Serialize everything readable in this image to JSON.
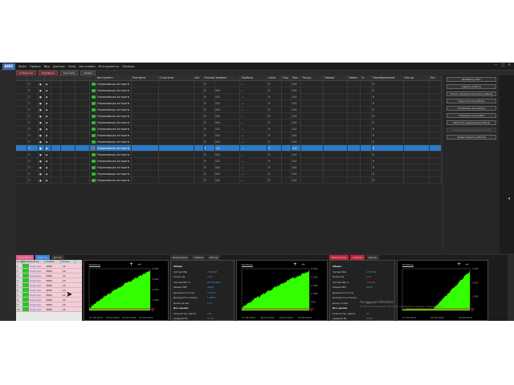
{
  "app": {
    "logo": "AIBX",
    "menu": [
      "Файл",
      "Правка",
      "Вид",
      "Данные",
      "Окно",
      "Настройки",
      "Инструменты",
      "Помощь"
    ],
    "window_title": "",
    "controls": [
      "—",
      "□",
      "✕"
    ]
  },
  "toolbar_tabs": [
    "Стратегии",
    "Портфели",
    "Торговля",
    "Заявки"
  ],
  "grid": {
    "headers": [
      "",
      "",
      "",
      "",
      "",
      "",
      "",
      "",
      "Инструмент",
      "Портфель",
      "Стратегия",
      "Акт",
      "Позиция",
      "Уровень",
      "Прибыль",
      "Цена",
      "Код",
      "Вых",
      "Текущ.",
      "Заявки",
      "Лимит",
      "%",
      "Подтверждение",
      "Кол-во",
      "Лот"
    ],
    "rows": [
      {
        "status": "on",
        "inst": "Управляющая алгоритм",
        "pos": "0",
        "lvl": "",
        "pnl": "—",
        "price": "0",
        "p2": "",
        "a": "0.0",
        "b": "",
        "c": "",
        "d": "",
        "e": "0"
      },
      {
        "status": "on",
        "inst": "Управляющая алгоритм",
        "pos": "0",
        "lvl": "0.0",
        "pnl": "—",
        "price": "0",
        "p2": "",
        "a": "0.0",
        "b": "",
        "c": "",
        "d": "",
        "e": "0"
      },
      {
        "status": "on",
        "inst": "Управляющая алгоритм",
        "pos": "0",
        "lvl": "0.0",
        "pnl": "—",
        "price": "0",
        "p2": "",
        "a": "0.0",
        "b": "",
        "c": "",
        "d": "",
        "e": "0"
      },
      {
        "status": "on",
        "inst": "Управляющая алгоритм",
        "pos": "0",
        "lvl": "0.0",
        "pnl": "—",
        "price": "0",
        "p2": "",
        "a": "0.0",
        "b": "",
        "c": "",
        "d": "",
        "e": "0"
      },
      {
        "status": "on",
        "inst": "Управляющая алгоритм",
        "pos": "0",
        "lvl": "0.0",
        "pnl": "—",
        "price": "0",
        "p2": "",
        "a": "0.0",
        "b": "",
        "c": "",
        "d": "",
        "e": "0"
      },
      {
        "status": "on",
        "inst": "Управляющая алгоритм",
        "pos": "0",
        "lvl": "0.0",
        "pnl": "—",
        "price": "0",
        "p2": "",
        "a": "0.0",
        "b": "",
        "c": "",
        "d": "",
        "e": "0"
      },
      {
        "status": "on",
        "inst": "Управляющая алгоритм",
        "pos": "0",
        "lvl": "0.0",
        "pnl": "—",
        "price": "0",
        "p2": "",
        "a": "0.0",
        "b": "",
        "c": "",
        "d": "",
        "e": "0"
      },
      {
        "status": "on",
        "inst": "Управляющая алгоритм",
        "pos": "0",
        "lvl": "0.0",
        "pnl": "—",
        "price": "0",
        "p2": "",
        "a": "0.0",
        "b": "",
        "c": "",
        "d": "",
        "e": "0"
      },
      {
        "status": "on",
        "inst": "Управляющая алгоритм",
        "pos": "0",
        "lvl": "0.0",
        "pnl": "—",
        "price": "0",
        "p2": "",
        "a": "0.0",
        "b": "",
        "c": "",
        "d": "",
        "e": "0"
      },
      {
        "status": "on",
        "inst": "Управляющая алгоритм",
        "pos": "0",
        "lvl": "0.0",
        "pnl": "—",
        "price": "0",
        "p2": "",
        "a": "0.0",
        "b": "",
        "c": "",
        "d": "",
        "e": "0"
      },
      {
        "status": "off",
        "inst": "Управляющая алгоритм",
        "pos": "1",
        "lvl": "0.0",
        "pnl": "—",
        "price": "0",
        "p2": "",
        "a": "0.0",
        "b": "",
        "c": "",
        "d": "",
        "e": "0",
        "selected": true
      },
      {
        "status": "on",
        "inst": "Управляющая алгоритм",
        "pos": "0",
        "lvl": "0.0",
        "pnl": "—",
        "price": "0",
        "p2": "",
        "a": "0.0",
        "b": "",
        "c": "",
        "d": "",
        "e": "0"
      },
      {
        "status": "on",
        "inst": "Управляющая алгоритм",
        "pos": "0",
        "lvl": "0.0",
        "pnl": "—",
        "price": "0",
        "p2": "",
        "a": "0.0",
        "b": "",
        "c": "",
        "d": "",
        "e": "0"
      },
      {
        "status": "on",
        "inst": "Управляющая алгоритм",
        "pos": "0",
        "lvl": "0.0",
        "pnl": "—",
        "price": "0",
        "p2": "",
        "a": "0.0",
        "b": "",
        "c": "",
        "d": "",
        "e": "0"
      },
      {
        "status": "on",
        "inst": "Управляющая алгоритм",
        "pos": "0",
        "lvl": "0.0",
        "pnl": "—",
        "price": "0",
        "p2": "",
        "a": "0.0",
        "b": "",
        "c": "",
        "d": "",
        "e": "0"
      },
      {
        "status": "on",
        "inst": "Управляющая алгоритм",
        "pos": "0",
        "lvl": "0.0",
        "pnl": "—",
        "price": "0",
        "p2": "",
        "a": "0.0",
        "b": "",
        "c": "",
        "d": "",
        "e": "0"
      }
    ]
  },
  "side_buttons": [
    {
      "label": "Добавить робот",
      "dim": false
    },
    {
      "label": "Удалить роботы",
      "dim": false
    },
    {
      "label": "Начать продажу/торговать заявкой",
      "dim": false
    },
    {
      "label": "Запустить все роботы",
      "dim": false
    },
    {
      "label": "Остановить все роботы",
      "dim": false
    },
    {
      "label": "Сохранить настройки",
      "dim": false
    },
    {
      "label": "Запустить выделенные роботы",
      "dim": false
    },
    {
      "label": "Остановить выделенные роботы",
      "dim": true
    },
    {
      "label": "Редактировать роботов",
      "dim": false
    }
  ],
  "bottom_tabs": [
    {
      "label": "Портфели",
      "style": "pink"
    },
    {
      "label": "Сделки",
      "style": "blue"
    },
    {
      "label": "Доход",
      "style": "plain"
    },
    {
      "label": "Результаты",
      "style": "plain"
    },
    {
      "label": "Сделки",
      "style": "plain"
    },
    {
      "label": "Доход",
      "style": "plain"
    },
    {
      "label": "Результаты",
      "style": "red"
    },
    {
      "label": "Сделки",
      "style": "red"
    },
    {
      "label": "Доход",
      "style": "plain"
    }
  ],
  "deals_list": {
    "headers": [
      "Номер",
      "Направление",
      "Символ",
      "Кол-во"
    ],
    "rows": [
      {
        "n": "1",
        "dir": "Короткая",
        "sym": "VBM4",
        "qty": "-20"
      },
      {
        "n": "2",
        "dir": "Короткая",
        "sym": "VBM4",
        "qty": "-20"
      },
      {
        "n": "3",
        "dir": "Короткая",
        "sym": "VBM4",
        "qty": "-20"
      },
      {
        "n": "4",
        "dir": "Короткая",
        "sym": "VBM4",
        "qty": "-20"
      },
      {
        "n": "5",
        "dir": "Короткая",
        "sym": "VBM4",
        "qty": "-20"
      },
      {
        "n": "6",
        "dir": "Короткая",
        "sym": "VBM4",
        "qty": "-20"
      },
      {
        "n": "7",
        "dir": "Короткая",
        "sym": "VBM4",
        "qty": "-20"
      },
      {
        "n": "8",
        "dir": "Короткая",
        "sym": "VBM4",
        "qty": "-20"
      },
      {
        "n": "9",
        "dir": "Короткая",
        "sym": "VBM4",
        "qty": "-20"
      },
      {
        "n": "10",
        "dir": "Короткая",
        "sym": "VBM4",
        "qty": "-20"
      }
    ]
  },
  "charts": [
    {
      "title": "Прибыль",
      "xticks": [
        "27.04.2023",
        "28.04.2023",
        "02.05.2023",
        "03.05.2023"
      ],
      "yticks": [
        "4 000",
        "3 000",
        "2 000",
        "1 000",
        "0"
      ]
    },
    {
      "title": "Прибыль",
      "xticks": [
        "27.04.2023",
        "28.04.2023",
        "02.05.2023",
        "03.05.2023"
      ],
      "yticks": [
        "2 500",
        "2 000",
        "1 500",
        "1 000",
        "500",
        "0"
      ]
    },
    {
      "title": "Прибыль",
      "xticks": [
        "27.04.2023",
        "02.05.2023",
        "03.05.2023"
      ],
      "yticks": [
        "3 000",
        "2 000",
        "1 000",
        "0"
      ]
    }
  ],
  "stats_panels": [
    {
      "rows": [
        {
          "label": "Общие",
          "value": "",
          "head": true
        },
        {
          "label": "Чистый P&L",
          "value": "3 909.00",
          "red": false
        },
        {
          "label": "Комиссия",
          "value": "0.00",
          "red": true
        },
        {
          "label": "Чистый P&L %",
          "value": "18 216.00%",
          "red": false
        },
        {
          "label": "Общий MFE",
          "value": "29.00",
          "red": false
        },
        {
          "label": "Доходность в год",
          "value": "3 213%",
          "red": false
        },
        {
          "label": "Доходность в месяц",
          "value": "1 090%",
          "red": false
        },
        {
          "label": "Доход за бар",
          "value": "0.11",
          "red": false
        },
        {
          "label": "Все сделки",
          "value": "",
          "head": true
        },
        {
          "label": "Количество сделок",
          "value": "118",
          "red": false
        },
        {
          "label": "Средний P/L",
          "value": "33.13",
          "red": false
        },
        {
          "label": "Средний P/L %",
          "value": "29.52%",
          "red": false
        },
        {
          "label": "Бары за сделку в ср.",
          "value": "106.74",
          "red": false
        },
        {
          "label": "Прибыльные сделки",
          "value": "",
          "head": true
        },
        {
          "label": "Выигрыши сделки",
          "value": "106",
          "red": false
        },
        {
          "label": "Выигрыш %",
          "value": "89.83%",
          "red": false
        }
      ]
    },
    {
      "rows": [
        {
          "label": "Общие",
          "value": "",
          "head": true
        },
        {
          "label": "Чистый P&L",
          "value": "2 413.00",
          "red": false
        },
        {
          "label": "Комиссия",
          "value": "0.00",
          "red": true
        },
        {
          "label": "Чистый P&L %",
          "value": "-23.00%",
          "red": true
        },
        {
          "label": "Общий MFE",
          "value": "28.00",
          "red": false
        },
        {
          "label": "Доходность в год",
          "value": "",
          "red": false
        },
        {
          "label": "Доходность в месяц",
          "value": "",
          "red": false
        },
        {
          "label": "Доход за бар",
          "value": "0.21",
          "red": false
        },
        {
          "label": "Все сделки",
          "value": "",
          "head": true
        },
        {
          "label": "Количество сделок",
          "value": "27",
          "red": false
        },
        {
          "label": "Средний P/L",
          "value": "89.37",
          "red": false
        },
        {
          "label": "Средний P/L %",
          "value": "17.23%",
          "red": false
        },
        {
          "label": "Бары за сделку в ср.",
          "value": "82.52",
          "red": false
        },
        {
          "label": "Прибыльные сделки",
          "value": "",
          "head": true
        },
        {
          "label": "Выигрыши сделки",
          "value": "25",
          "red": false
        },
        {
          "label": "Выигрыш %",
          "value": "92.59%",
          "red": false
        }
      ]
    }
  ],
  "watermark": {
    "line1": "Активация Windows",
    "line2": "Чтобы активировать Windows, перейдите в раздел «Параметры»."
  },
  "colors": {
    "accent_green": "#2ec22e",
    "selection_blue": "#2a7cc7",
    "stat_blue": "#4a9be8",
    "stat_red": "#e05050",
    "chart_fill": "#33ff00"
  }
}
